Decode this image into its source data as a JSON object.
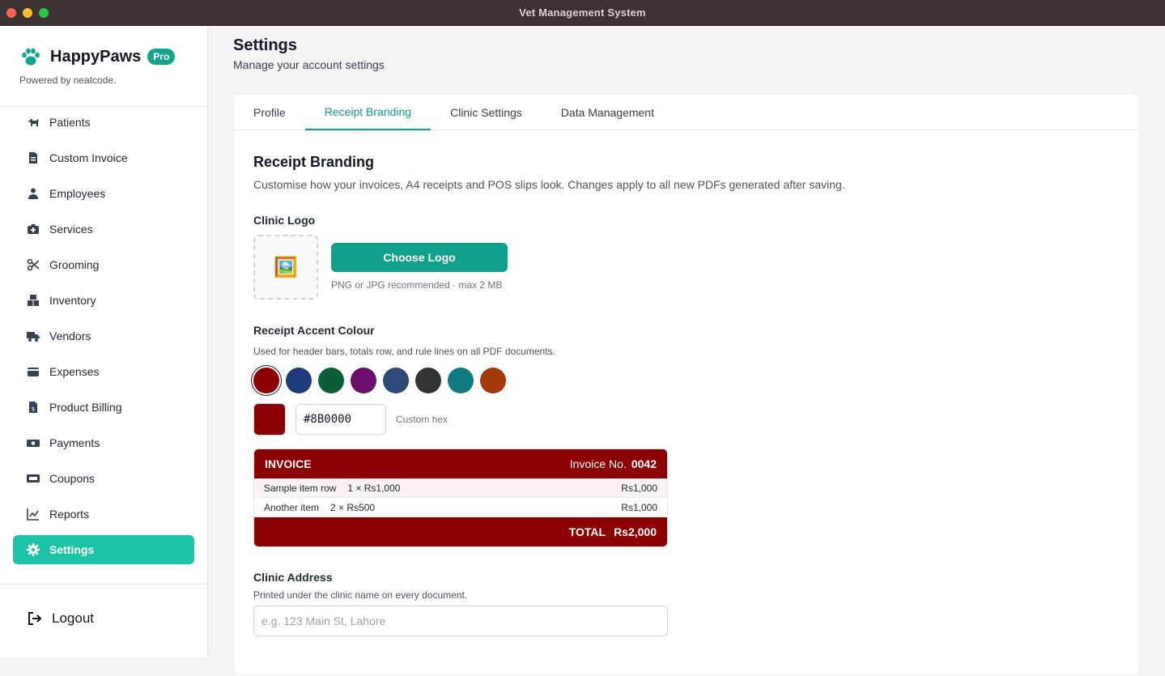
{
  "window": {
    "title": "Vet Management System"
  },
  "brand": {
    "name": "HappyPaws",
    "badge": "Pro",
    "powered_by": "Powered by neatcode."
  },
  "sidebar": {
    "items": [
      {
        "label": "Patients",
        "icon": "dog-icon"
      },
      {
        "label": "Custom Invoice",
        "icon": "file-invoice-icon"
      },
      {
        "label": "Employees",
        "icon": "user-tie-icon"
      },
      {
        "label": "Services",
        "icon": "medical-kit-icon"
      },
      {
        "label": "Grooming",
        "icon": "scissors-icon"
      },
      {
        "label": "Inventory",
        "icon": "boxes-icon"
      },
      {
        "label": "Vendors",
        "icon": "truck-icon"
      },
      {
        "label": "Expenses",
        "icon": "wallet-icon"
      },
      {
        "label": "Product Billing",
        "icon": "receipt-icon"
      },
      {
        "label": "Payments",
        "icon": "money-icon"
      },
      {
        "label": "Coupons",
        "icon": "ticket-icon"
      },
      {
        "label": "Reports",
        "icon": "chart-line-icon"
      },
      {
        "label": "Settings",
        "icon": "gear-icon",
        "active": true
      }
    ],
    "logout_label": "Logout"
  },
  "header": {
    "title": "Settings",
    "subtitle": "Manage your account settings"
  },
  "tabs": [
    {
      "label": "Profile"
    },
    {
      "label": "Receipt Branding",
      "active": true
    },
    {
      "label": "Clinic Settings"
    },
    {
      "label": "Data Management"
    }
  ],
  "branding": {
    "title": "Receipt Branding",
    "description": "Customise how your invoices, A4 receipts and POS slips look. Changes apply to all new PDFs generated after saving.",
    "logo": {
      "label": "Clinic Logo",
      "placeholder_icon": "🖼️",
      "button_label": "Choose Logo",
      "hint": "PNG or JPG recommended · max 2 MB"
    },
    "accent": {
      "label": "Receipt Accent Colour",
      "hint": "Used for header bars, totals row, and rule lines on all PDF documents.",
      "swatches": [
        "#8B0000",
        "#1E3A7A",
        "#0B5E3A",
        "#6B0F6B",
        "#2C4A78",
        "#333333",
        "#0F7B80",
        "#A23A0A"
      ],
      "selected": "#8B0000",
      "hex_value": "#8B0000",
      "custom_hint": "Custom hex"
    },
    "preview": {
      "heading": "INVOICE",
      "invoice_label": "Invoice No.",
      "invoice_number": "0042",
      "rows": [
        {
          "name": "Sample item row",
          "qty": "1 × Rs1,000",
          "amount": "Rs1,000"
        },
        {
          "name": "Another item",
          "qty": "2 × Rs500",
          "amount": "Rs1,000"
        }
      ],
      "total_label": "TOTAL",
      "total_value": "Rs2,000"
    },
    "address": {
      "label": "Clinic Address",
      "hint": "Printed under the clinic name on every document.",
      "placeholder": "e.g. 123 Main St, Lahore",
      "value": ""
    }
  },
  "colors": {
    "accent_teal": "#11a08a",
    "active_nav": "#1cc4a5",
    "receipt_accent": "#8B0000"
  }
}
